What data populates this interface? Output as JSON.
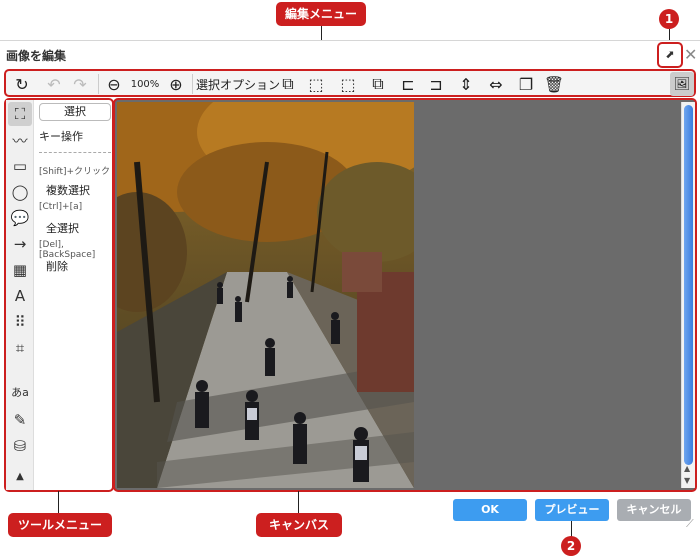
{
  "callouts": {
    "edit_menu": "編集メニュー",
    "tool_menu": "ツールメニュー",
    "canvas": "キャンバス",
    "badge_1": "1",
    "badge_2": "2"
  },
  "dialog": {
    "title": "画像を編集",
    "popout_glyph": "⬈",
    "close_glyph": "✕"
  },
  "toolbar": {
    "reset_glyph": "↻",
    "undo_glyph": "↶",
    "redo_glyph": "↷",
    "zoom_out_glyph": "⊖",
    "zoom_level": "100%",
    "zoom_in_glyph": "⊕",
    "select_option_label": "選択オプション",
    "option_glyphs": [
      "⧉",
      "⬚",
      "⬚",
      "⧉",
      "⊏",
      "⊐",
      "⇕",
      "⇔",
      "❐",
      "🗑"
    ],
    "image_lock_glyph": "🖼"
  },
  "tools": {
    "glyphs": [
      "⛶",
      "〰",
      "▭",
      "◯",
      "💬",
      "→",
      "▦",
      "A",
      "⠿",
      "⌗",
      "あa",
      "✎",
      "⛁",
      "▲"
    ],
    "select_label": "選択",
    "key_ops_title": "キー操作",
    "shortcuts": [
      {
        "key": "[Shift]+クリック",
        "action": "複数選択"
      },
      {
        "key": "[Ctrl]+[a]",
        "action": "全選択"
      },
      {
        "key": "[Del],[BackSpace]",
        "action": "削除"
      }
    ]
  },
  "canvas": {
    "scroll_up": "▲",
    "scroll_down": "▼"
  },
  "buttons": {
    "ok": "OK",
    "preview": "プレビュー",
    "cancel": "キャンセル"
  },
  "colors": {
    "accent_red": "#cc1f1f",
    "primary_blue": "#3d9cf0",
    "secondary_gray": "#a9adb2"
  }
}
